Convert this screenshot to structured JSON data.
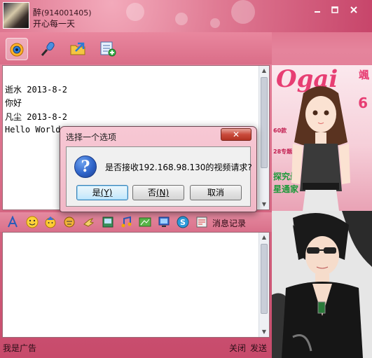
{
  "header": {
    "nickname": "醉",
    "qq_number": "(914001405)",
    "signature": "开心每一天",
    "window_controls": [
      "minimize-icon",
      "maximize-icon",
      "close-icon"
    ]
  },
  "toolbar": {
    "buttons": [
      "video-chat-icon",
      "voice-chat-icon",
      "send-file-icon",
      "apps-icon"
    ]
  },
  "messages": [
    {
      "text": "逝水 2013-8-2"
    },
    {
      "text": "你好"
    },
    {
      "text": "凡尘 2013-8-2"
    },
    {
      "text": "Hello World"
    }
  ],
  "format_bar": {
    "icons": [
      "font-icon",
      "emoji-icon",
      "magic-emoticon-icon",
      "nudge-icon",
      "gesture-icon",
      "screenshot-icon",
      "music-icon",
      "image-icon",
      "remote-desktop-icon",
      "security-icon",
      "shake-icon"
    ],
    "history_label": "消息记录"
  },
  "bottom": {
    "ad_label": "我是广告",
    "close_label": "关闭",
    "send_label": "发送"
  },
  "ad_images": {
    "magazine_title": "Ogai",
    "magazine_side": "颯",
    "magazine_number": "6",
    "magazine_tags": [
      "60款",
      "28专题",
      "探究最",
      "星通家"
    ]
  },
  "dialog": {
    "title": "选择一个选项",
    "close_label": "✕",
    "message": "是否接收192.168.98.130的视频请求?",
    "yes_label": "是",
    "yes_accel": "(Y)",
    "no_label": "否",
    "no_accel": "(N)",
    "cancel_label": "取消"
  }
}
